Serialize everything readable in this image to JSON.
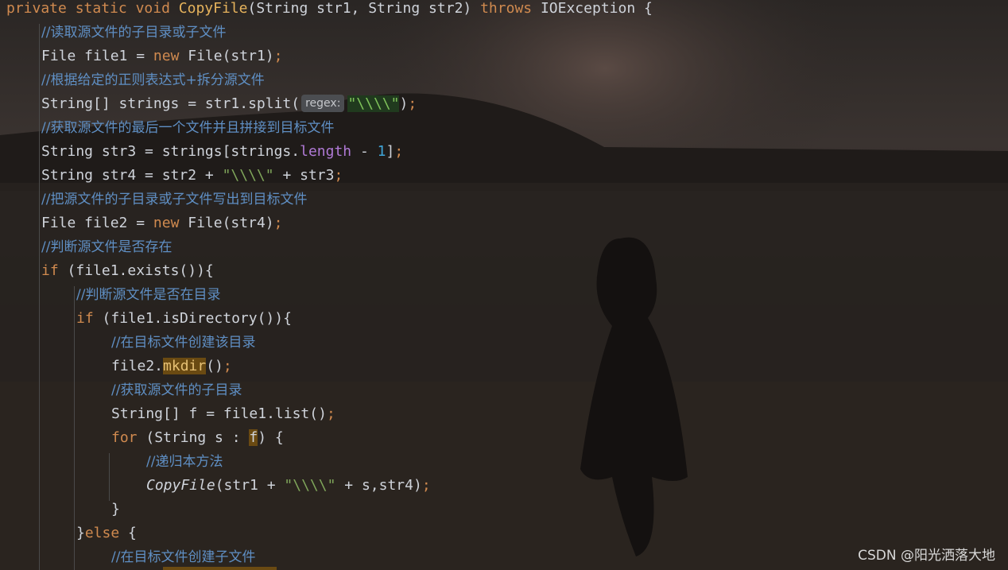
{
  "code": {
    "line1": {
      "kw_private": "private",
      "kw_static": "static",
      "kw_void": "void",
      "method": "CopyFile",
      "params": "(String str1, String str2) ",
      "kw_throws": "throws",
      "exc": " IOException {"
    },
    "line2": "//读取源文件的子目录或子文件",
    "line3": {
      "a": "File file1 = ",
      "kw": "new",
      "b": " File(str1)",
      "semi": ";"
    },
    "line4": "//根据给定的正则表达式+拆分源文件",
    "line5": {
      "a": "String[] strings = str1.split(",
      "hint": "regex:",
      "str": "\"\\\\\\\\\"",
      "b": ")",
      "semi": ";"
    },
    "line6": "//获取源文件的最后一个文件并且拼接到目标文件",
    "line7": {
      "a": "String str3 = strings[strings.",
      "fld": "length",
      "b": " - ",
      "num": "1",
      "c": "]",
      "semi": ";"
    },
    "line8": {
      "a": "String str4 = str2 + ",
      "str": "\"\\\\\\\\\"",
      "b": " + str3",
      "semi": ";"
    },
    "line9": "//把源文件的子目录或子文件写出到目标文件",
    "line10": {
      "a": "File file2 = ",
      "kw": "new",
      "b": " File(str4)",
      "semi": ";"
    },
    "line11": "//判断源文件是否存在",
    "line12": {
      "kw": "if",
      "b": " (file1.exists()){"
    },
    "line13": "//判断源文件是否在目录",
    "line14": {
      "kw": "if",
      "b": " (file1.isDirectory()){"
    },
    "line15": "//在目标文件创建该目录",
    "line16": {
      "a": "file2.",
      "hl": "mkdir",
      "b": "()",
      "semi": ";"
    },
    "line17": "//获取源文件的子目录",
    "line18": {
      "a": "String[] f = file1.list()",
      "semi": ";"
    },
    "line19": {
      "kw": "for",
      "a": " (String s : ",
      "hl": "f",
      "b": ") {"
    },
    "line20": "//递归本方法",
    "line21": {
      "it": "CopyFile",
      "a": "(str1 + ",
      "str": "\"\\\\\\\\\"",
      "b": " + s,str4)",
      "semi": ";"
    },
    "line22": "}",
    "line23": {
      "a": "}",
      "kw": "else",
      "b": " {"
    },
    "line24": "//在目标文件创建子文件"
  },
  "watermark": "CSDN @阳光洒落大地",
  "colors": {
    "keyword": "#d08a4f",
    "method": "#e6b35c",
    "comment": "#5f8fc4",
    "string": "#7fa55a",
    "number": "#3fa5d8",
    "field": "#b07ad6"
  }
}
